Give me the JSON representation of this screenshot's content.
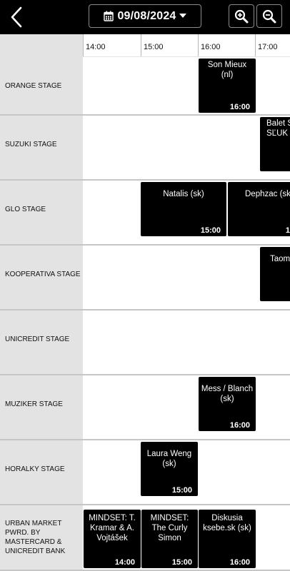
{
  "header": {
    "back_icon": "chevron-left-icon",
    "date": "09/08/2024",
    "calendar_icon": "calendar-icon",
    "dropdown_icon": "caret-down-icon",
    "zoom_in_icon": "zoom-in-icon",
    "zoom_out_icon": "zoom-out-icon"
  },
  "timeline": {
    "times": [
      "14:00",
      "15:00",
      "16:00",
      "17:00"
    ]
  },
  "stages": [
    {
      "name": "ORANGE STAGE",
      "events": [
        {
          "title": "Son Mieux (nl)",
          "time": "16:00"
        }
      ]
    },
    {
      "name": "SUZUKI STAGE",
      "events": [
        {
          "title": "Balet S SĽUK",
          "time": ""
        }
      ]
    },
    {
      "name": "GLO STAGE",
      "events": [
        {
          "title": "Natalis (sk)",
          "time": "15:00"
        },
        {
          "title": "Dephzac (sk",
          "time": "1"
        }
      ]
    },
    {
      "name": "KOOPERATIVA STAGE",
      "events": [
        {
          "title": "Taom",
          "time": ""
        }
      ]
    },
    {
      "name": "UNICREDIT STAGE",
      "events": []
    },
    {
      "name": "MUZIKER STAGE",
      "events": [
        {
          "title": "Mess / Blanch (sk)",
          "time": "16:00"
        }
      ]
    },
    {
      "name": "HORALKY STAGE",
      "events": [
        {
          "title": "Laura Weng (sk)",
          "time": "15:00"
        }
      ]
    },
    {
      "name": "URBAN MARKET PWRD. BY MASTERCARD & UNICREDIT BANK",
      "events": [
        {
          "title": "MINDSET: T. Kramar & A. Vojtášek",
          "time": "14:00"
        },
        {
          "title": "MINDSET: The Curly Simon",
          "time": "15:00"
        },
        {
          "title": "Diskusia ksebe.sk (sk)",
          "time": "16:00"
        }
      ]
    }
  ],
  "colors": {
    "header_bg": "#000000",
    "event_bg": "#000000",
    "event_text": "#ffffff",
    "stage_label_bg": "#e3e3e3"
  }
}
